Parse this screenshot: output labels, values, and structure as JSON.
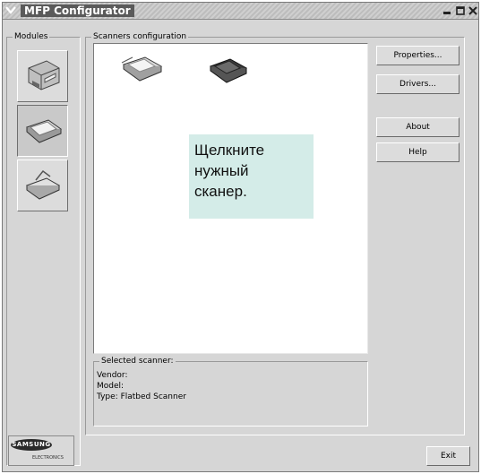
{
  "window": {
    "title": "MFP Configurator"
  },
  "modules": {
    "label": "Modules",
    "items": [
      {
        "name": "printer-module",
        "icon": "printer-icon",
        "active": false
      },
      {
        "name": "scanner-module",
        "icon": "scanner-icon",
        "active": true
      },
      {
        "name": "card-reader-module",
        "icon": "card-reader-icon",
        "active": false
      }
    ]
  },
  "scanners": {
    "label": "Scanners configuration",
    "items": [
      {
        "name": "scanner-1",
        "icon": "flatbed-scanner-icon"
      },
      {
        "name": "scanner-2",
        "icon": "flatbed-scanner-dark-icon"
      }
    ]
  },
  "callout": {
    "lines": [
      "Щелкните",
      "нужный",
      "сканер."
    ]
  },
  "selected": {
    "label": "Selected scanner:",
    "vendor": "Vendor:",
    "model": "Model:",
    "type": "Type: Flatbed Scanner"
  },
  "buttons": {
    "properties": "Properties...",
    "drivers": "Drivers...",
    "about": "About",
    "help": "Help",
    "exit": "Exit"
  },
  "brand": {
    "name": "SAMSUNG",
    "sub": "ELECTRONICS"
  }
}
